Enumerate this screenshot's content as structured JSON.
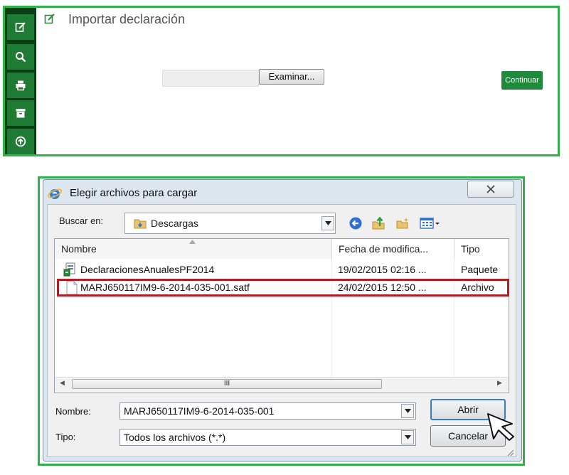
{
  "top_panel": {
    "title": "Importar declaración",
    "file_path_value": "",
    "browse_label": "Examinar...",
    "continue_label": "Continuar",
    "toolbar_icons": [
      "edit-icon",
      "search-icon",
      "print-icon",
      "archive-icon",
      "upload-icon"
    ],
    "accent_color": "#2db34a",
    "toolbar_color": "#1f7a33"
  },
  "dialog": {
    "title": "Elegir archivos para cargar",
    "look_in_label": "Buscar en:",
    "look_in_value": "Descargas",
    "columns": [
      "Nombre",
      "Fecha de modifica...",
      "Tipo"
    ],
    "files": [
      {
        "name": "DeclaracionesAnualesPF2014",
        "date": "19/02/2015 02:16 ...",
        "type": "Paquete"
      },
      {
        "name": "MARJ650117IM9-6-2014-035-001.satf",
        "date": "24/02/2015 12:50 ...",
        "type": "Archivo"
      }
    ],
    "scroll_grip": "III",
    "filename_label": "Nombre:",
    "filename_value": "MARJ650117IM9-6-2014-035-001",
    "filetype_label": "Tipo:",
    "filetype_value": "Todos los archivos (*.*)",
    "open_label": "Abrir",
    "cancel_label": "Cancelar",
    "highlight_color": "#b01e23"
  }
}
